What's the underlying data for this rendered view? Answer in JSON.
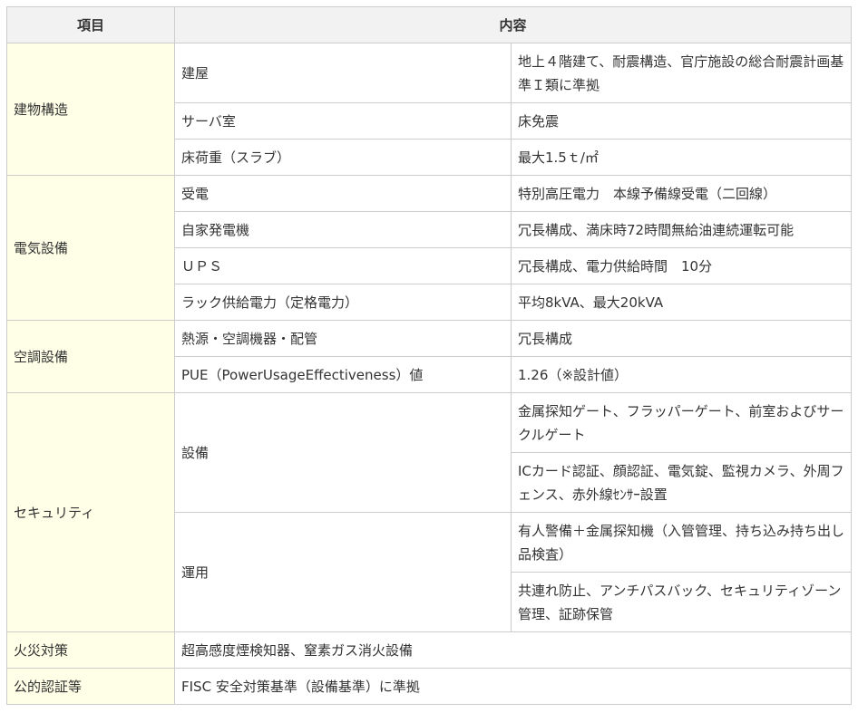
{
  "header": {
    "item": "項目",
    "content": "内容"
  },
  "building": {
    "label": "建物構造",
    "rows": [
      {
        "name": "建屋",
        "value": "地上４階建て、耐震構造、官庁施設の総合耐震計画基準Ｉ類に準拠"
      },
      {
        "name": "サーバ室",
        "value": "床免震"
      },
      {
        "name": "床荷重（スラブ）",
        "value": "最大1.5ｔ/㎡"
      }
    ]
  },
  "electrical": {
    "label": "電気設備",
    "rows": [
      {
        "name": "受電",
        "value": "特別高圧電力　本線予備線受電（二回線）"
      },
      {
        "name": "自家発電機",
        "value": "冗長構成、満床時72時間無給油連続運転可能"
      },
      {
        "name": "ＵＰＳ",
        "value": "冗長構成、電力供給時間　10分"
      },
      {
        "name": "ラック供給電力（定格電力）",
        "value": "平均8kVA、最大20kVA"
      }
    ]
  },
  "hvac": {
    "label": "空調設備",
    "rows": [
      {
        "name": "熱源・空調機器・配管",
        "value": "冗長構成"
      },
      {
        "name": "PUE（PowerUsageEffectiveness）値",
        "value": "1.26（※設計値）"
      }
    ]
  },
  "security": {
    "label": "セキュリティ",
    "equipment": {
      "name": "設備",
      "values": [
        "金属探知ゲート、フラッパーゲート、前室およびサークルゲート",
        "ICカード認証、顔認証、電気錠、監視カメラ、外周フェンス、赤外線ｾﾝｻｰ設置"
      ]
    },
    "operation": {
      "name": "運用",
      "values": [
        "有人警備＋金属探知機（入管管理、持ち込み持ち出し品検査）",
        "共連れ防止、アンチパスバック、セキュリティゾーン管理、証跡保管"
      ]
    }
  },
  "fire": {
    "label": "火災対策",
    "value": "超高感度煙検知器、窒素ガス消火設備"
  },
  "certification": {
    "label": "公的認証等",
    "value": "FISC 安全対策基準（設備基準）に準拠"
  }
}
